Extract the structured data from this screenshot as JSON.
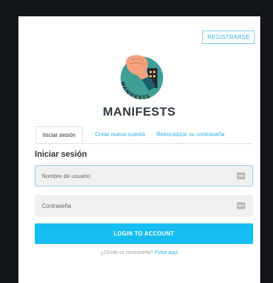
{
  "header": {
    "register_label": "REGISTRARSE"
  },
  "brand": {
    "name": "MANIFESTS",
    "logo_text": "MANIFESTS"
  },
  "tabs": [
    {
      "label": "Iniciar sesión",
      "active": true
    },
    {
      "label": "Crear nueva cuenta",
      "active": false
    },
    {
      "label": "Reinicializar su contraseña",
      "active": false
    }
  ],
  "form": {
    "title": "Iniciar sesión",
    "username": {
      "value": "",
      "placeholder": "Nombre de usuario"
    },
    "password": {
      "value": "",
      "placeholder": "Contraseña"
    },
    "submit_label": "LOGIN TO ACCOUNT",
    "forgot_text": "¿Olvidó su contraseña?",
    "forgot_link": "Pulse aquí"
  },
  "colors": {
    "accent": "#17bdf0",
    "link": "#29aee3",
    "page_background": "#13171c",
    "logo_circle": "#3f9f97"
  },
  "icons": {
    "field_action": "more-dots-icon"
  }
}
